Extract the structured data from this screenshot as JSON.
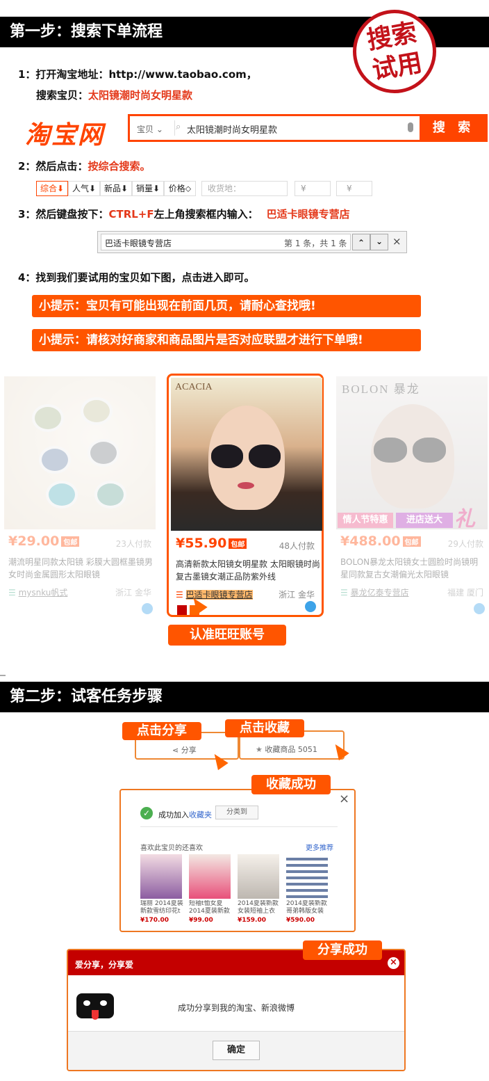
{
  "step1": {
    "title": "第一步：搜索下单流程",
    "stamp_line1": "搜索",
    "stamp_line2": "试用",
    "line1_prefix": "1：打开淘宝地址：http://www.taobao.com，",
    "line1b_prefix": "搜索宝贝：",
    "line1b_value": "太阳镜潮时尚女明星款",
    "logo": "淘宝网",
    "search_category": "宝贝 ⌄",
    "search_query": "太阳镜潮时尚女明星款",
    "search_button": "搜 索",
    "line2_prefix": "2：然后点击：",
    "line2_value": "按综合搜索。",
    "sort_tabs": [
      "综合⬇",
      "人气⬇",
      "新品⬇",
      "销量⬇",
      "价格⬦"
    ],
    "sort_location": "收货地：",
    "price_from": "¥",
    "price_to": "¥",
    "line3_prefix": "3：然后键盘按下：",
    "line3_key": "CTRL+F",
    "line3_mid": "左上角搜索框内输入：",
    "line3_value": "巴适卡眼镜专营店",
    "find_text": "巴适卡眼镜专营店",
    "find_count": "第 1 条，共 1 条",
    "find_up": "⌃",
    "find_down": "⌄",
    "find_close": "×",
    "line4": "4：找到我们要试用的宝贝如下图，点击进入即可。",
    "tip1": "小提示：宝贝有可能出现在前面几页，请耐心查找哦!",
    "tip2": "小提示：请核对好商家和商品图片是否对应联盟才进行下单哦!"
  },
  "products": [
    {
      "price": "¥29.00",
      "baoyou": "包邮",
      "buyers": "23人付款",
      "title": "潮流明星同款太阳镜 彩膜大圆框墨镜男女时尚金属圆形太阳眼镜",
      "shop": "mysnku帆式",
      "loc": "浙江 金华",
      "brand": ""
    },
    {
      "price": "¥55.90",
      "baoyou": "包邮",
      "buyers": "48人付款",
      "title": "高清新款太阳镜女明星款 太阳眼镜时尚复古墨镜女潮正品防紫外线",
      "shop": "巴适卡眼镜专营店",
      "loc": "浙江 金华",
      "brand": "ACACIA"
    },
    {
      "price": "¥488.00",
      "baoyou": "包邮",
      "buyers": "29人付款",
      "title": "BOLON暴龙太阳镜女士圆脸时尚镜明星同款复古女潮偏光太阳眼镜",
      "shop": "暴龙亿泰专营店",
      "loc": "福建 厦门",
      "brand": "BOLON 暴龙",
      "banner1": "情人节特惠",
      "banner2": "进店送大",
      "banner3": "礼"
    }
  ],
  "callout_wangwang": "认准旺旺账号",
  "step2": {
    "title": "第二步：试客任务步骤",
    "click_share": "点击分享",
    "click_fav": "点击收藏",
    "share_label": "分享",
    "fav_label": "收藏商品 5051",
    "fav_success": "收藏成功",
    "fav_added_prefix": "成功加入",
    "fav_added_link": "收藏夹",
    "fav_group_btn": "分类到",
    "fav_like_title": "喜欢此宝贝的还喜欢",
    "fav_more": "更多推荐",
    "fav_items": [
      {
        "title": "瑞丽 2014夏装新款雪纺印花t",
        "price": "¥170.00"
      },
      {
        "title": "短袖t恤女夏 2014夏装新款",
        "price": "¥99.00"
      },
      {
        "title": "2014夏装新款女装短袖上衣",
        "price": "¥159.00"
      },
      {
        "title": "2014夏装新款哥弟韩版女装",
        "price": "¥590.00"
      }
    ],
    "share_success": "分享成功",
    "share_dialog_title": "爱分享，分享爱",
    "share_dialog_msg": "成功分享到我的淘宝、新浪微博",
    "share_dialog_btn": "确定",
    "close_x": "×"
  },
  "colors": {
    "accent": "#ff5500",
    "taobao": "#ff4400",
    "stamp": "#c3121a",
    "dialog_header": "#c40000"
  }
}
